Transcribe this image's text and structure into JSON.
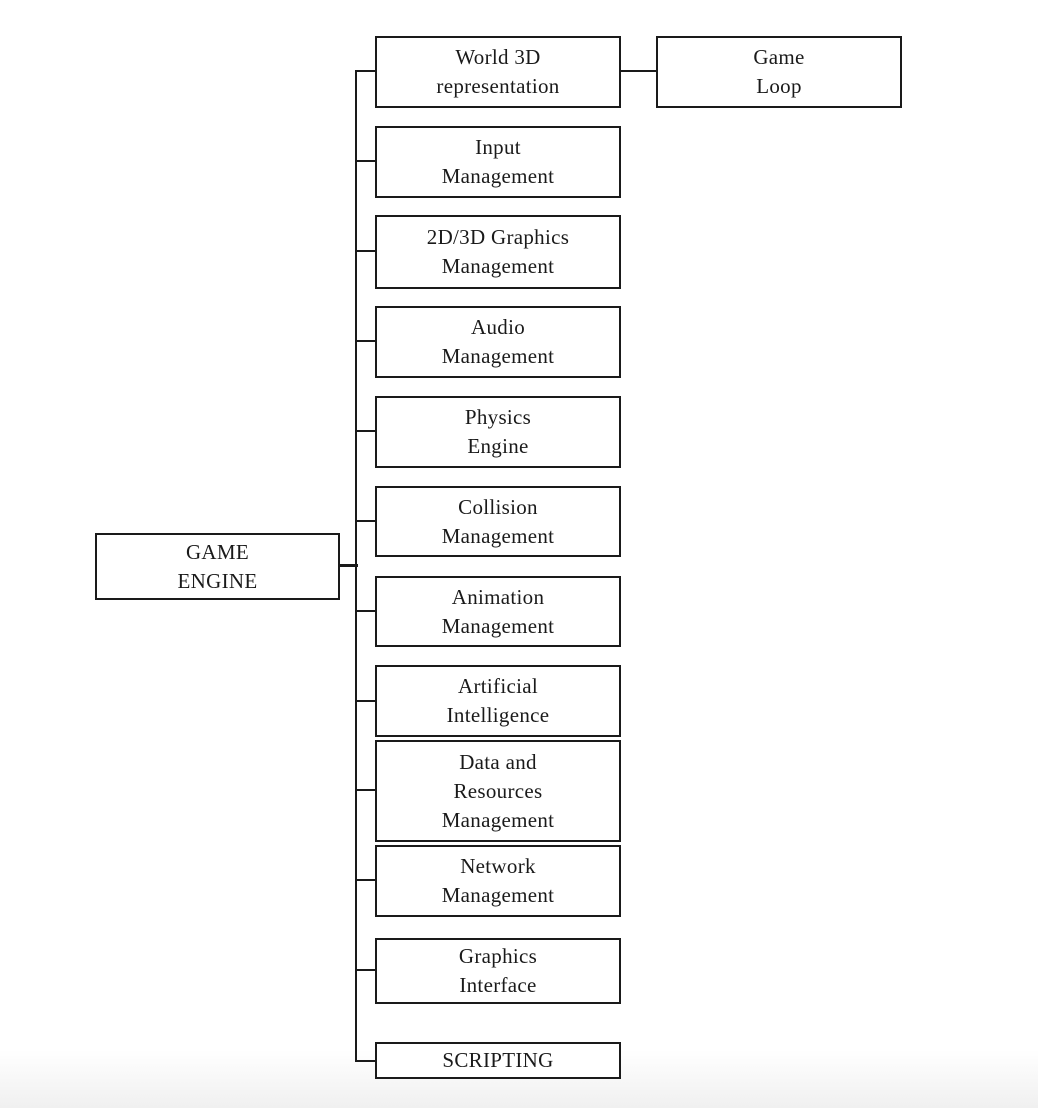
{
  "diagram": {
    "root": {
      "label": "GAME\nENGINE"
    },
    "children": [
      {
        "label": "World 3D\nrepresentation"
      },
      {
        "label": "Input\nManagement"
      },
      {
        "label": "2D/3D Graphics\nManagement"
      },
      {
        "label": "Audio\nManagement"
      },
      {
        "label": "Physics\nEngine"
      },
      {
        "label": "Collision\nManagement"
      },
      {
        "label": "Animation\nManagement"
      },
      {
        "label": "Artificial\nIntelligence"
      },
      {
        "label": "Data and\nResources\nManagement"
      },
      {
        "label": "Network\nManagement"
      },
      {
        "label": "Graphics\nInterface"
      },
      {
        "label": "SCRIPTING"
      }
    ],
    "grandchild": {
      "parent_index": 0,
      "label": "Game\nLoop"
    },
    "colors": {
      "stroke": "#1a1a1a",
      "fill": "#ffffff"
    }
  }
}
